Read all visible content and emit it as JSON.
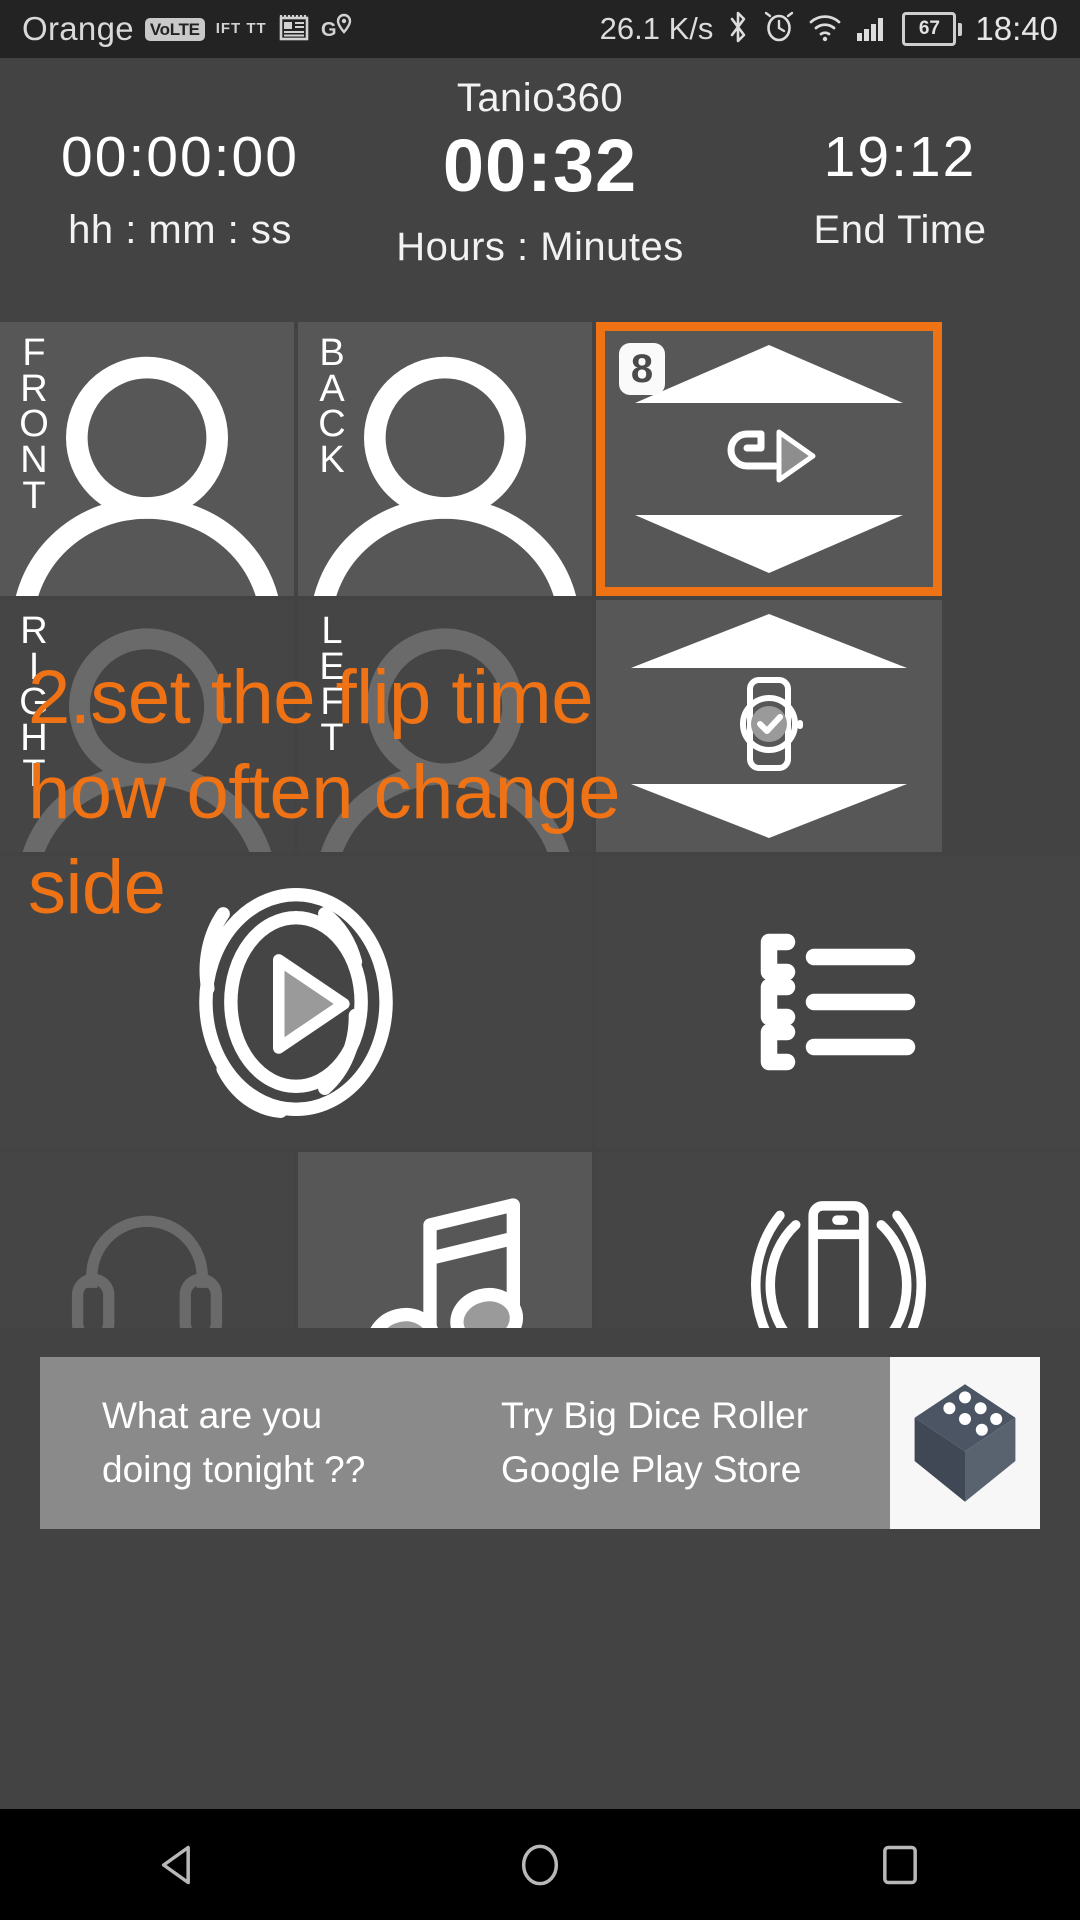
{
  "status_bar": {
    "carrier": "Orange",
    "volte_badge": "VoLTE",
    "ifttt_label_top": "IFT",
    "ifttt_label_bottom": "TT",
    "network_speed": "26.1 K/s",
    "battery_percent": "67",
    "clock": "18:40",
    "icons": [
      "volte-icon",
      "ifttt-icon",
      "news-icon",
      "maps-icon",
      "bluetooth-icon",
      "alarm-icon",
      "wifi-icon",
      "signal-icon",
      "battery-icon"
    ]
  },
  "app": {
    "title": "Tanio360",
    "timers": [
      {
        "value": "00:00:00",
        "label": "hh : mm : ss",
        "name": "elapsed-timer"
      },
      {
        "value": "00:32",
        "label": "Hours : Minutes",
        "name": "duration-timer"
      },
      {
        "value": "19:12",
        "label": "End Time",
        "name": "end-time"
      }
    ]
  },
  "tiles": {
    "front": {
      "label": [
        "F",
        "R",
        "O",
        "N",
        "T"
      ],
      "icon": "person-icon"
    },
    "back": {
      "label": [
        "B",
        "A",
        "C",
        "K"
      ],
      "icon": "person-icon"
    },
    "flip_time": {
      "badge": "8",
      "icon": "flip-rotate-icon",
      "up": "increase",
      "down": "decrease"
    },
    "right": {
      "label": [
        "R",
        "I",
        "G",
        "H",
        "T"
      ],
      "icon": "person-icon"
    },
    "left": {
      "label": [
        "L",
        "E",
        "F",
        "T"
      ],
      "icon": "person-icon"
    },
    "watch": {
      "icon": "smartwatch-icon",
      "up": "increase",
      "down": "decrease"
    },
    "play": {
      "icon": "play-circle-icon"
    },
    "list": {
      "icon": "list-icon"
    },
    "headset": {
      "icon": "headset-icon"
    },
    "music": {
      "icon": "music-note-icon"
    },
    "vibrate": {
      "icon": "vibrate-phone-icon"
    }
  },
  "annotation": {
    "text": "2.set the flip time how often change side",
    "color": "#ef7215"
  },
  "ad": {
    "line1": "What are you",
    "line2": "doing tonight ??",
    "line3": "Try Big Dice Roller",
    "line4": "Google Play Store",
    "icon": "dice-icon"
  },
  "nav_bar": {
    "back": "back-button",
    "home": "home-button",
    "recents": "recents-button"
  },
  "colors": {
    "accent": "#ef7215",
    "tile": "#575757",
    "tile_dark": "#454545",
    "background": "#434343",
    "status_bar": "#232323"
  }
}
